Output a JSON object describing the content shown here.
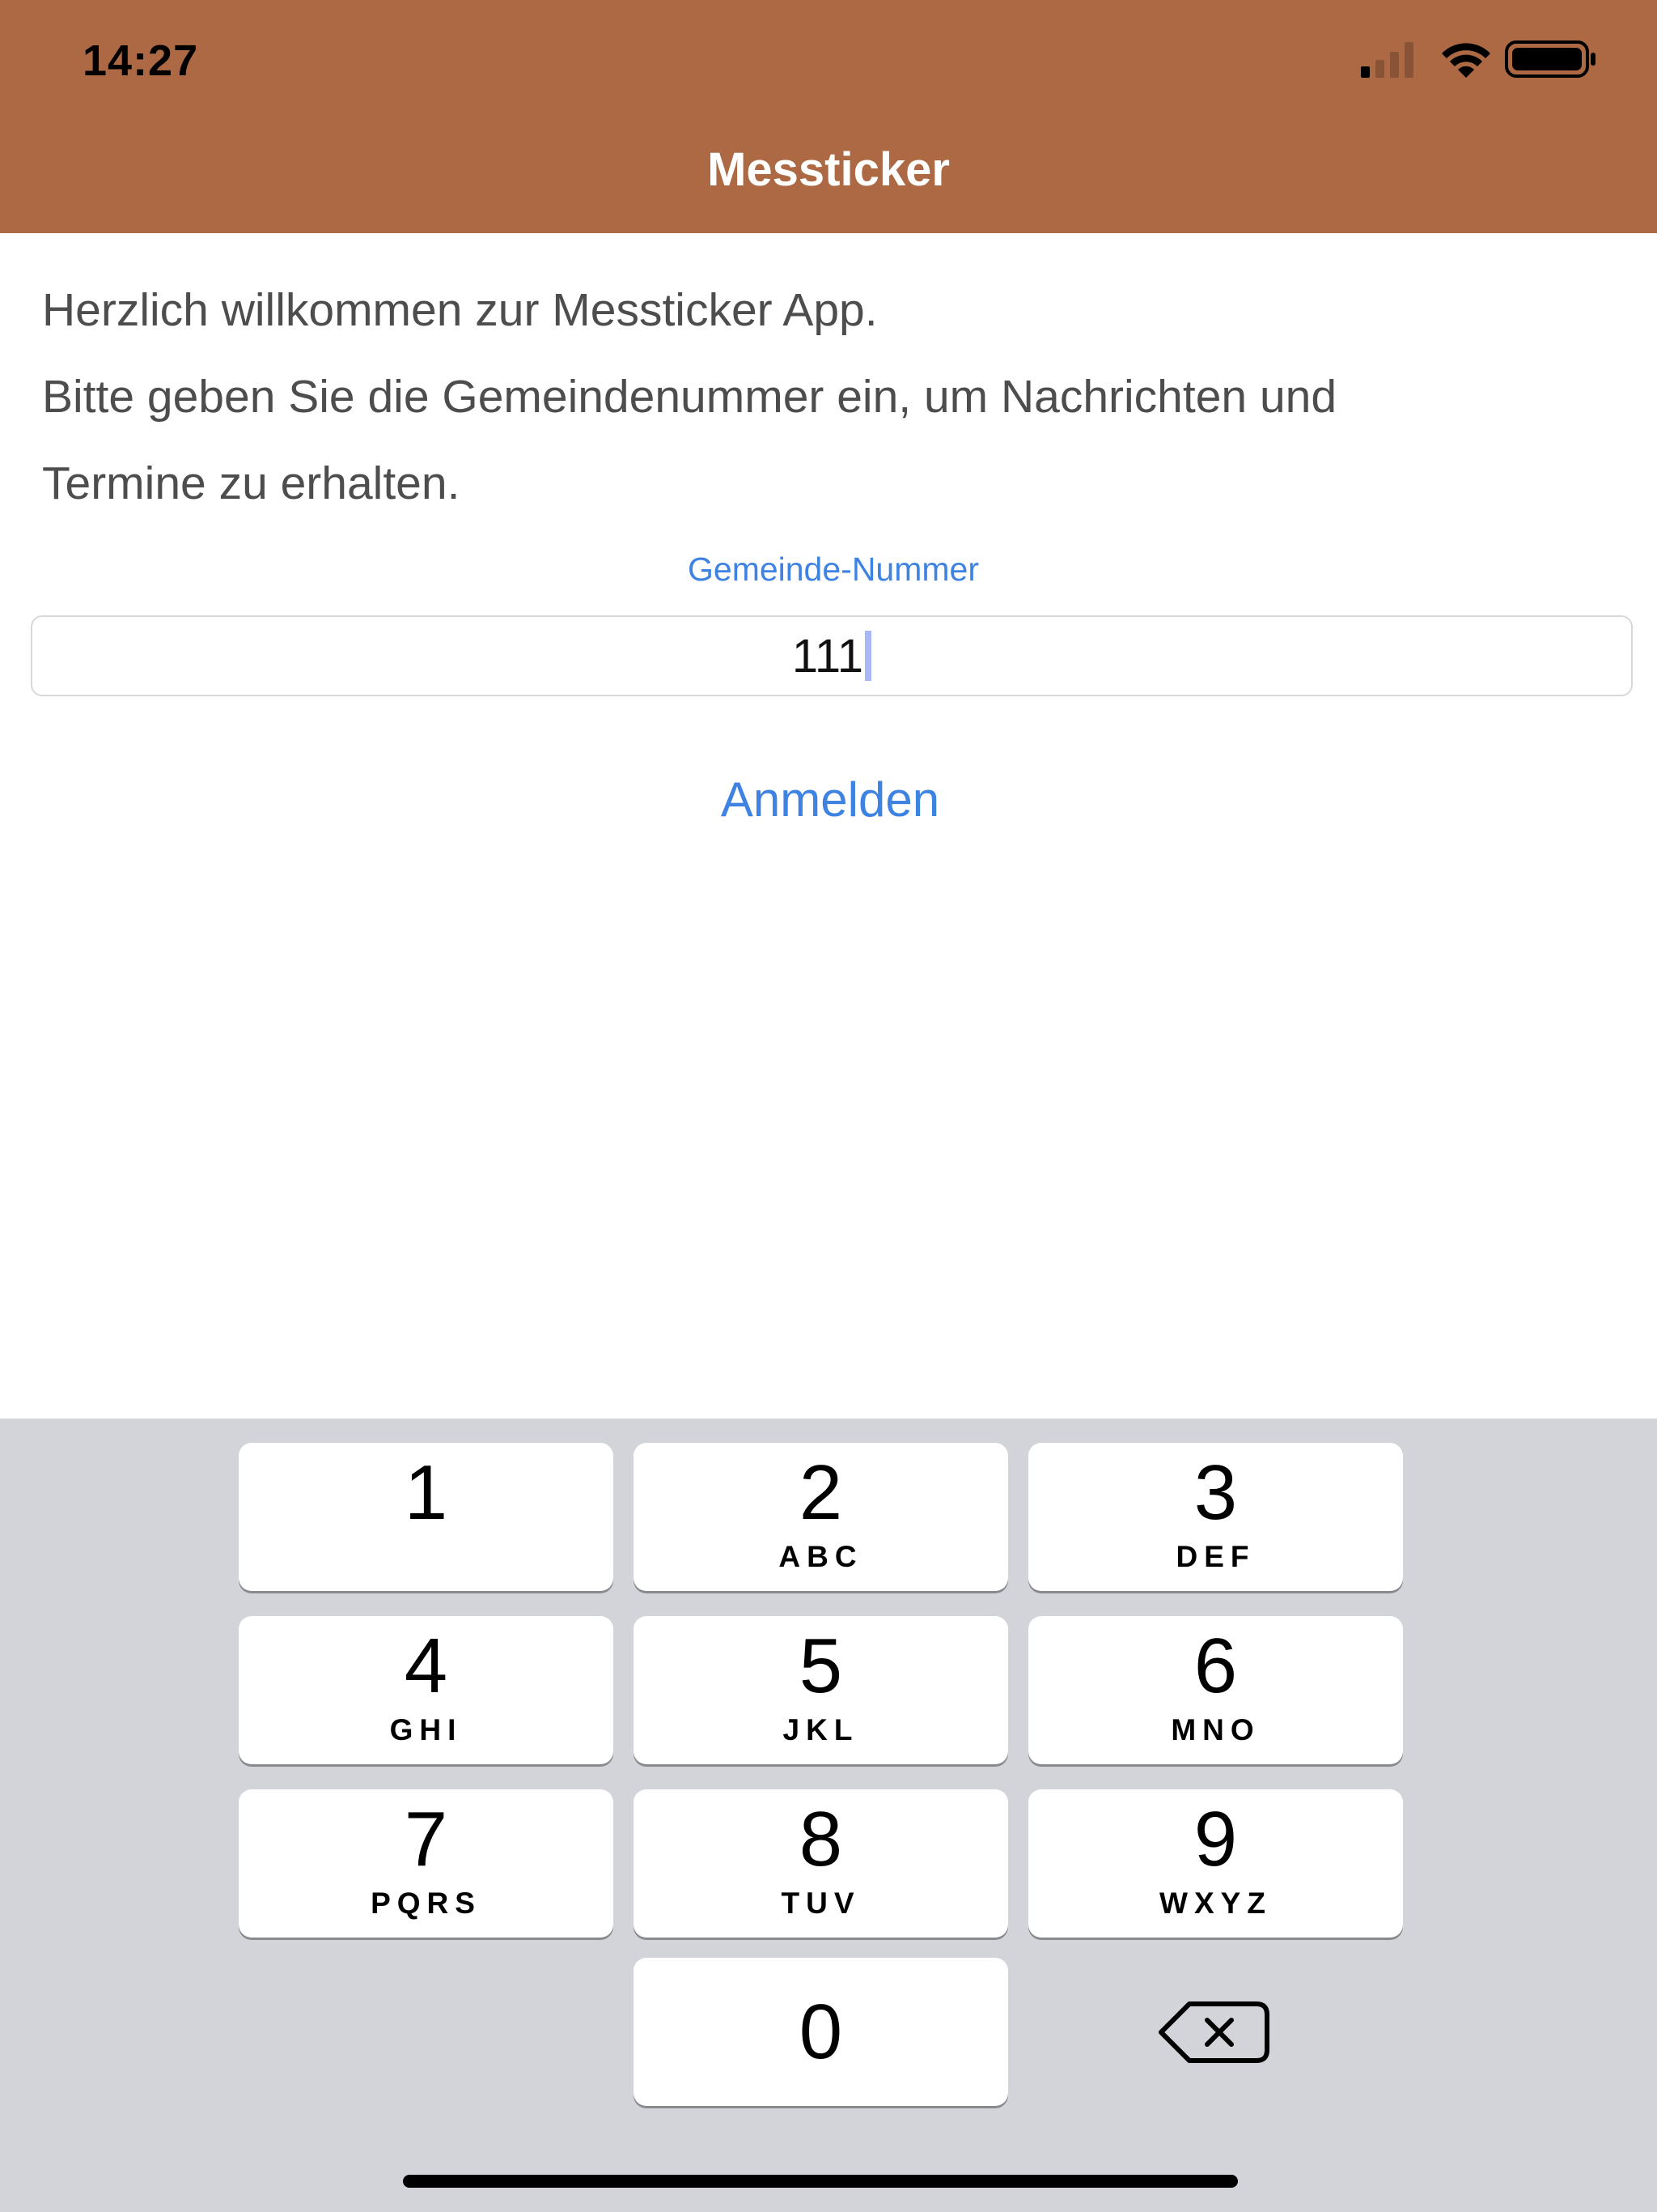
{
  "status_bar": {
    "time": "14:27"
  },
  "header": {
    "title": "Messticker",
    "background": "#AC6943"
  },
  "intro": {
    "line1": "Herzlich willkommen zur Messticker App.",
    "line2": "Bitte geben Sie die Gemeindenummer ein, um Nachrichten und",
    "line3": "Termine zu erhalten."
  },
  "form": {
    "label": "Gemeinde-Nummer",
    "value": "111",
    "login_label": "Anmelden",
    "accent": "#3E82E2"
  },
  "keypad": {
    "keys": [
      {
        "digit": "1",
        "letters": ""
      },
      {
        "digit": "2",
        "letters": "ABC"
      },
      {
        "digit": "3",
        "letters": "DEF"
      },
      {
        "digit": "4",
        "letters": "GHI"
      },
      {
        "digit": "5",
        "letters": "JKL"
      },
      {
        "digit": "6",
        "letters": "MNO"
      },
      {
        "digit": "7",
        "letters": "PQRS"
      },
      {
        "digit": "8",
        "letters": "TUV"
      },
      {
        "digit": "9",
        "letters": "WXYZ"
      },
      {
        "digit": "0",
        "letters": ""
      }
    ],
    "backspace_icon": "delete-left-icon"
  }
}
